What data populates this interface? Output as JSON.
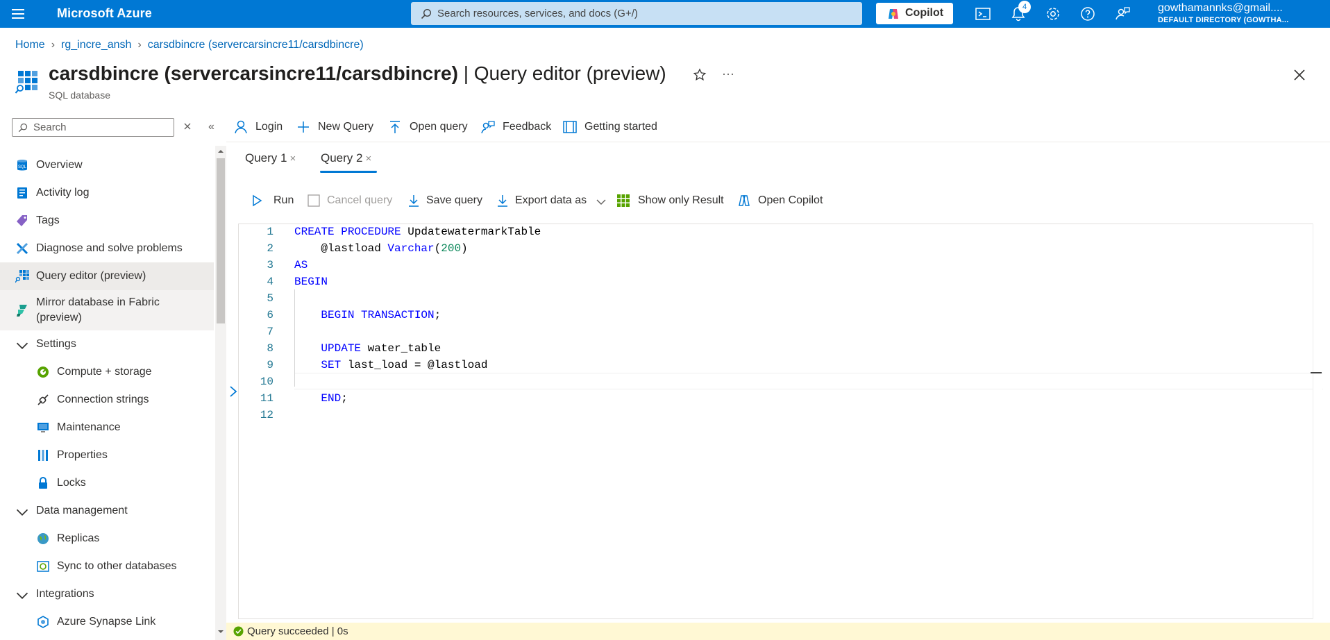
{
  "topbar": {
    "brand": "Microsoft Azure",
    "search_placeholder": "Search resources, services, and docs (G+/)",
    "copilot_label": "Copilot",
    "notification_count": "4",
    "user_email": "gowthamannks@gmail....",
    "user_directory": "DEFAULT DIRECTORY (GOWTHA..."
  },
  "breadcrumb": [
    "Home",
    "rg_incre_ansh",
    "carsdbincre (servercarsincre11/carsdbincre)"
  ],
  "resource": {
    "name": "carsdbincre (servercarsincre11/carsdbincre)",
    "page": " | Query editor (preview)",
    "type": "SQL database"
  },
  "nav": {
    "search_placeholder": "Search",
    "items": [
      {
        "label": "Overview",
        "icon": "sql-icon"
      },
      {
        "label": "Activity log",
        "icon": "log-icon"
      },
      {
        "label": "Tags",
        "icon": "tag-icon"
      },
      {
        "label": "Diagnose and solve problems",
        "icon": "wrench-icon"
      },
      {
        "label": "Query editor (preview)",
        "icon": "query-editor-icon"
      },
      {
        "label": "Mirror database in Fabric",
        "label2": "(preview)",
        "icon": "fabric-icon"
      },
      {
        "label": "Settings",
        "icon": "chevron-down-icon"
      },
      {
        "label": "Compute + storage",
        "icon": "compute-icon"
      },
      {
        "label": "Connection strings",
        "icon": "plug-icon"
      },
      {
        "label": "Maintenance",
        "icon": "monitor-icon"
      },
      {
        "label": "Properties",
        "icon": "properties-icon"
      },
      {
        "label": "Locks",
        "icon": "lock-icon"
      },
      {
        "label": "Data management",
        "icon": "chevron-down-icon"
      },
      {
        "label": "Replicas",
        "icon": "globe-icon"
      },
      {
        "label": "Sync to other databases",
        "icon": "sync-icon"
      },
      {
        "label": "Integrations",
        "icon": "chevron-down-icon"
      },
      {
        "label": "Azure Synapse Link",
        "icon": "synapse-icon"
      }
    ]
  },
  "commands": {
    "login": "Login",
    "new_query": "New Query",
    "open_query": "Open query",
    "feedback": "Feedback",
    "getting_started": "Getting started"
  },
  "tabs": [
    {
      "label": "Query 1",
      "close": "×"
    },
    {
      "label": "Query 2",
      "close": "×"
    }
  ],
  "query_toolbar": {
    "run": "Run",
    "cancel": "Cancel query",
    "save": "Save query",
    "export": "Export data as",
    "show_result": "Show only Result",
    "open_copilot": "Open Copilot"
  },
  "editor": {
    "line_numbers": [
      "1",
      "2",
      "3",
      "4",
      "5",
      "6",
      "7",
      "8",
      "9",
      "10",
      "11",
      "12"
    ]
  },
  "status": {
    "text": "Query succeeded | 0s"
  },
  "colors": {
    "azure_blue": "#0078d4",
    "keyword": "#0000ff",
    "number": "#098658",
    "status_bg": "#fff8d4",
    "success": "#57a300"
  }
}
